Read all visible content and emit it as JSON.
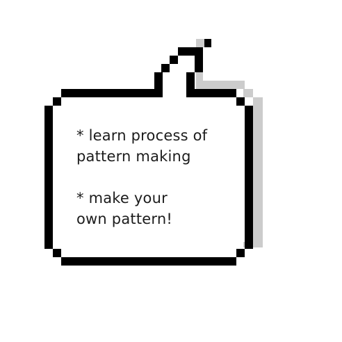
{
  "bubble": {
    "lines": [
      "* learn process of",
      "pattern making",
      "",
      "* make your",
      "own pattern!"
    ]
  },
  "colors": {
    "outline": "#000000",
    "shadow": "#cccccc",
    "fill": "#ffffff",
    "text": "#1c1c1c"
  }
}
